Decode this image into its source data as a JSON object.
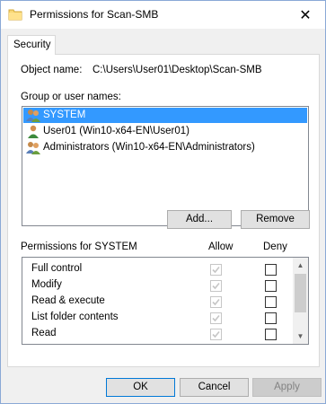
{
  "window": {
    "title": "Permissions for Scan-SMB",
    "close_glyph": "✕"
  },
  "tabs": [
    {
      "label": "Security"
    }
  ],
  "object": {
    "label": "Object name:",
    "value": "C:\\Users\\User01\\Desktop\\Scan-SMB"
  },
  "groups": {
    "label": "Group or user names:",
    "items": [
      {
        "name": "SYSTEM",
        "selected": true,
        "icon": "users-group-icon"
      },
      {
        "name": "User01 (Win10-x64-EN\\User01)",
        "selected": false,
        "icon": "user-icon"
      },
      {
        "name": "Administrators (Win10-x64-EN\\Administrators)",
        "selected": false,
        "icon": "users-group-icon"
      }
    ]
  },
  "buttons": {
    "add": "Add...",
    "remove": "Remove",
    "ok": "OK",
    "cancel": "Cancel",
    "apply": "Apply"
  },
  "permissions": {
    "label": "Permissions for SYSTEM",
    "allow_header": "Allow",
    "deny_header": "Deny",
    "rows": [
      {
        "name": "Full control",
        "allow": true,
        "deny": false
      },
      {
        "name": "Modify",
        "allow": true,
        "deny": false
      },
      {
        "name": "Read & execute",
        "allow": true,
        "deny": false
      },
      {
        "name": "List folder contents",
        "allow": true,
        "deny": false
      },
      {
        "name": "Read",
        "allow": true,
        "deny": false
      },
      {
        "name": "",
        "allow": true,
        "deny": false
      }
    ]
  },
  "colors": {
    "selection": "#3399ff",
    "accent_border": "#0078d7",
    "checkbox_disabled": "#c6c6c6"
  }
}
